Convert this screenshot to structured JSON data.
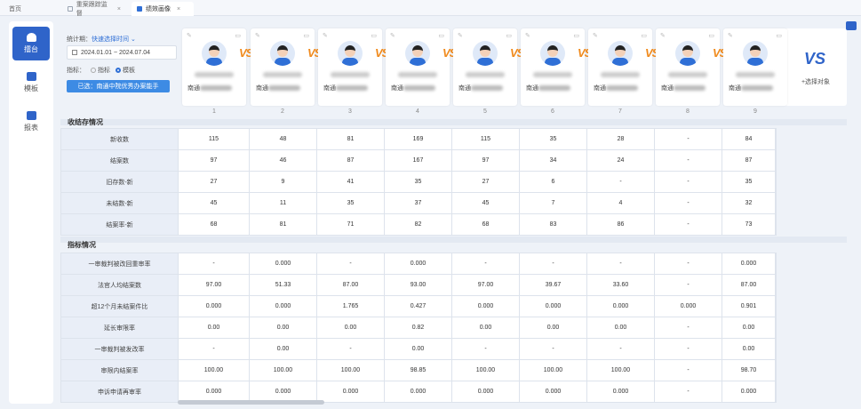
{
  "tabs": [
    {
      "label": "首页",
      "active": false
    },
    {
      "label": "重案跟踪监督",
      "active": false
    },
    {
      "label": "绩效画像",
      "active": true
    }
  ],
  "sidebar": [
    {
      "label": "擂台",
      "icon": "trophy-icon",
      "active": true
    },
    {
      "label": "模板",
      "icon": "template-icon",
      "active": false
    },
    {
      "label": "报表",
      "icon": "report-icon",
      "active": false
    }
  ],
  "filters": {
    "period_label": "统计期：",
    "quick_link": "快速选择时间",
    "date_range": "2024.01.01 ~ 2024.07.04",
    "indicator_label": "指标：",
    "opt1": "指标",
    "opt2": "模板",
    "selected_prefix": "已选：",
    "selected_value": "南通中院优秀办案能手"
  },
  "cards": [
    {
      "index": "1",
      "org": "南通"
    },
    {
      "index": "2",
      "org": "南通"
    },
    {
      "index": "3",
      "org": "南通"
    },
    {
      "index": "4",
      "org": "南通"
    },
    {
      "index": "5",
      "org": "南通"
    },
    {
      "index": "6",
      "org": "南通"
    },
    {
      "index": "7",
      "org": "南通"
    },
    {
      "index": "8",
      "org": "南通"
    },
    {
      "index": "9",
      "org": "南通"
    }
  ],
  "vs_label": "VS",
  "add_card": {
    "icon_text": "VS",
    "label": "+选择对象"
  },
  "section1": {
    "title": "收结存情况",
    "rows": [
      {
        "label": "新收数",
        "values": [
          "115",
          "48",
          "81",
          "169",
          "115",
          "35",
          "28",
          "-",
          "84"
        ]
      },
      {
        "label": "结案数",
        "values": [
          "97",
          "46",
          "87",
          "167",
          "97",
          "34",
          "24",
          "-",
          "87"
        ]
      },
      {
        "label": "旧存数-新",
        "values": [
          "27",
          "9",
          "41",
          "35",
          "27",
          "6",
          "-",
          "-",
          "35"
        ]
      },
      {
        "label": "未结数-新",
        "values": [
          "45",
          "11",
          "35",
          "37",
          "45",
          "7",
          "4",
          "-",
          "32"
        ]
      },
      {
        "label": "结案率-新",
        "values": [
          "68",
          "81",
          "71",
          "82",
          "68",
          "83",
          "86",
          "-",
          "73"
        ]
      }
    ]
  },
  "section2": {
    "title": "指标情况",
    "rows": [
      {
        "label": "一审裁判被改回重审率",
        "values": [
          "-",
          "0.000",
          "-",
          "0.000",
          "-",
          "-",
          "-",
          "-",
          "0.000"
        ]
      },
      {
        "label": "法官人均结案数",
        "values": [
          "97.00",
          "51.33",
          "87.00",
          "93.00",
          "97.00",
          "39.67",
          "33.60",
          "-",
          "87.00"
        ]
      },
      {
        "label": "超12个月未结案件比",
        "values": [
          "0.000",
          "0.000",
          "1.765",
          "0.427",
          "0.000",
          "0.000",
          "0.000",
          "0.000",
          "0.901"
        ]
      },
      {
        "label": "延长审限率",
        "values": [
          "0.00",
          "0.00",
          "0.00",
          "0.82",
          "0.00",
          "0.00",
          "0.00",
          "-",
          "0.00"
        ]
      },
      {
        "label": "一审裁判被发改率",
        "values": [
          "-",
          "0.00",
          "-",
          "0.00",
          "-",
          "-",
          "-",
          "-",
          "0.00"
        ]
      },
      {
        "label": "审限内结案率",
        "values": [
          "100.00",
          "100.00",
          "100.00",
          "98.85",
          "100.00",
          "100.00",
          "100.00",
          "-",
          "98.70"
        ]
      },
      {
        "label": "申诉申请再审率",
        "values": [
          "0.000",
          "0.000",
          "0.000",
          "0.000",
          "0.000",
          "0.000",
          "0.000",
          "-",
          "0.000"
        ]
      }
    ]
  }
}
